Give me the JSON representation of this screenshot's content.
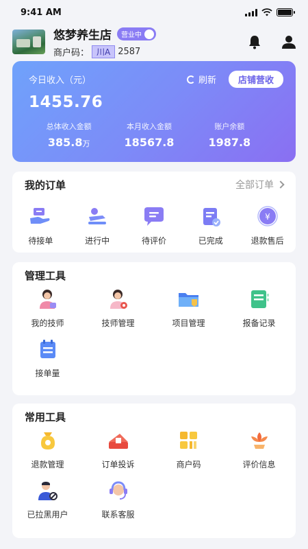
{
  "status_bar": {
    "time": "9:41 AM"
  },
  "header": {
    "store_name": "悠梦养生店",
    "open_status": "营业中",
    "merchant_code_label": "商户码：",
    "merchant_code_prefix": "川A",
    "merchant_code_number": "2587"
  },
  "income": {
    "today_label": "今日收入（元）",
    "today_value": "1455.76",
    "refresh_label": "刷新",
    "store_revenue_button": "店铺营收",
    "stats": [
      {
        "label": "总体收入金额",
        "value": "385.8",
        "unit": "万"
      },
      {
        "label": "本月收入金额",
        "value": "18567.8",
        "unit": ""
      },
      {
        "label": "账户余额",
        "value": "1987.8",
        "unit": ""
      }
    ]
  },
  "orders": {
    "title": "我的订单",
    "all_label": "全部订单",
    "items": [
      {
        "label": "待接单",
        "icon": "hand-money-icon"
      },
      {
        "label": "进行中",
        "icon": "massage-icon"
      },
      {
        "label": "待评价",
        "icon": "chat-bubble-icon"
      },
      {
        "label": "已完成",
        "icon": "clipboard-check-icon"
      },
      {
        "label": "退款售后",
        "icon": "yen-refund-icon"
      }
    ]
  },
  "management": {
    "title": "管理工具",
    "items": [
      {
        "label": "我的技师",
        "icon": "technician-icon"
      },
      {
        "label": "技师管理",
        "icon": "technician-manage-icon"
      },
      {
        "label": "项目管理",
        "icon": "folder-icon"
      },
      {
        "label": "报备记录",
        "icon": "record-list-icon"
      },
      {
        "label": "接单量",
        "icon": "calendar-list-icon"
      }
    ]
  },
  "common": {
    "title": "常用工具",
    "items": [
      {
        "label": "退款管理",
        "icon": "money-bag-icon"
      },
      {
        "label": "订单投诉",
        "icon": "complaint-icon"
      },
      {
        "label": "商户码",
        "icon": "qr-code-icon"
      },
      {
        "label": "评价信息",
        "icon": "flower-icon"
      },
      {
        "label": "已拉黑用户",
        "icon": "blocked-user-icon"
      },
      {
        "label": "联系客服",
        "icon": "headset-icon"
      }
    ]
  },
  "colors": {
    "accent": "#7c8cf8",
    "badge": "#8a7cf4",
    "background": "#f3f4f8"
  }
}
